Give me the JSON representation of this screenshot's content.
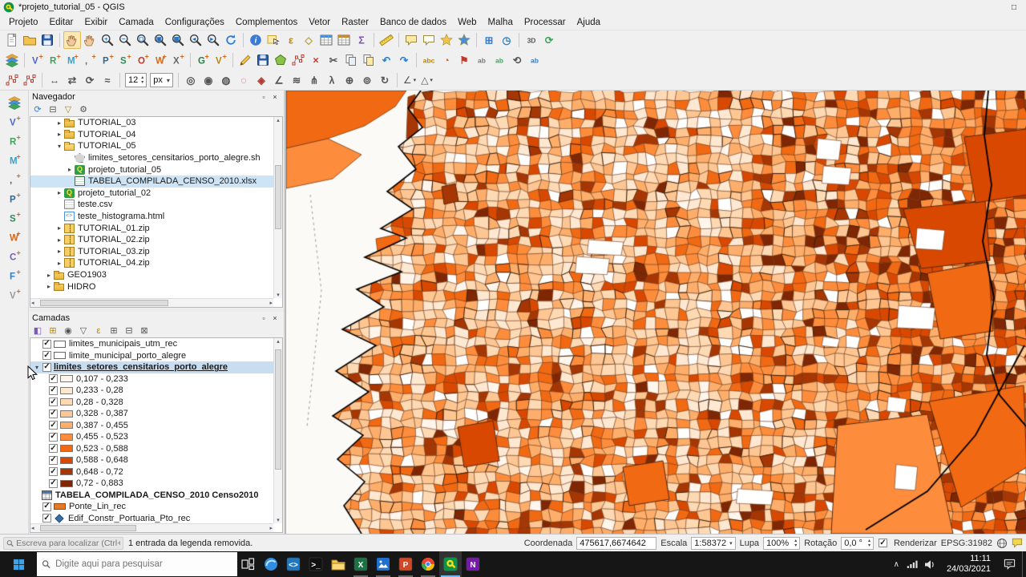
{
  "window": {
    "title": "*projeto_tutorial_05 - QGIS",
    "buttons": [
      {
        "n": "minimize-button",
        "g": "–"
      },
      {
        "n": "maximize-button",
        "g": "□"
      },
      {
        "n": "close-button",
        "g": "×"
      }
    ]
  },
  "icons": {
    "undock": "▫",
    "close": "×",
    "dropdown": "▾",
    "spin_up": "▴",
    "spin_down": "▾",
    "scroll_up": "▴",
    "scroll_down": "▾",
    "scroll_left": "◂",
    "scroll_right": "▸",
    "chevron_up": "∧",
    "check": "✓"
  },
  "menu": {
    "items": [
      "Projeto",
      "Editar",
      "Exibir",
      "Camada",
      "Configurações",
      "Complementos",
      "Vetor",
      "Raster",
      "Banco de dados",
      "Web",
      "Malha",
      "Processar",
      "Ajuda"
    ]
  },
  "toolbars": {
    "row1": [
      {
        "n": "project-new",
        "t": "file"
      },
      {
        "n": "project-open",
        "t": "folder"
      },
      {
        "n": "project-save",
        "t": "disk"
      },
      {
        "sep": true
      },
      {
        "n": "pan-map",
        "t": "hand",
        "active": true
      },
      {
        "n": "pan-to-selection",
        "t": "hand"
      },
      {
        "n": "zoom-in",
        "t": "mag",
        "g": "+"
      },
      {
        "n": "zoom-out",
        "t": "mag",
        "g": "−"
      },
      {
        "n": "zoom-full",
        "t": "mag",
        "g": "◻"
      },
      {
        "n": "zoom-to-selection",
        "t": "mag",
        "g": "▣"
      },
      {
        "n": "zoom-to-layer",
        "t": "mag",
        "g": "▦"
      },
      {
        "n": "zoom-last",
        "t": "mag",
        "g": "◂"
      },
      {
        "n": "zoom-next",
        "t": "mag",
        "g": "▸"
      },
      {
        "n": "map-refresh",
        "t": "refresh"
      },
      {
        "sep": true
      },
      {
        "n": "identify-features",
        "t": "info"
      },
      {
        "n": "select-features",
        "t": "sel"
      },
      {
        "n": "select-by-expression",
        "t": "glyph",
        "g": "ε",
        "c": "#b8860b"
      },
      {
        "n": "deselect-all",
        "t": "glyph",
        "g": "◇",
        "c": "#b8a13d"
      },
      {
        "n": "open-attribute-table",
        "t": "table"
      },
      {
        "n": "field-calculator",
        "t": "table",
        "c": "#c98a2d"
      },
      {
        "n": "statistical-summary",
        "t": "glyph",
        "g": "Σ",
        "c": "#7a5ab5"
      },
      {
        "sep": true
      },
      {
        "n": "measure-line",
        "t": "ruler"
      },
      {
        "sep": true
      },
      {
        "n": "map-tips",
        "t": "balloon",
        "c": "#fde9a8"
      },
      {
        "n": "new-annotation",
        "t": "balloon",
        "c": "#ffffff"
      },
      {
        "n": "new-spatial-bookmark",
        "t": "star",
        "c": "#f3c24e"
      },
      {
        "n": "show-spatial-bookmarks",
        "t": "star",
        "c": "#4a90d9"
      },
      {
        "sep": true
      },
      {
        "n": "new-map-view",
        "t": "glyph",
        "g": "⊞",
        "c": "#3a7bd5"
      },
      {
        "n": "temporal-controller",
        "t": "glyph",
        "g": "◷",
        "c": "#2d7dd2"
      },
      {
        "sep": true
      },
      {
        "n": "new-3d-map-view",
        "t": "glyph",
        "g": "3D",
        "c": "#555555",
        "small": true
      },
      {
        "n": "refresh-3d",
        "t": "glyph",
        "g": "⟳",
        "c": "#3da45c"
      }
    ],
    "row2": [
      {
        "n": "data-source-manager",
        "t": "layers"
      },
      {
        "sep": true
      },
      {
        "n": "add-vector-layer",
        "t": "ltr",
        "g": "V",
        "c": "#4c66c8"
      },
      {
        "n": "add-raster-layer",
        "t": "ltr",
        "g": "R",
        "c": "#3da45c"
      },
      {
        "n": "add-mesh-layer",
        "t": "ltr",
        "g": "M",
        "c": "#38a3c8"
      },
      {
        "n": "add-delimited-text-layer",
        "t": "ltr",
        "g": ",",
        "c": "#666666"
      },
      {
        "n": "add-postgis-layer",
        "t": "ltr",
        "g": "P",
        "c": "#336791"
      },
      {
        "n": "add-spatialite-layer",
        "t": "ltr",
        "g": "S",
        "c": "#2e8b57"
      },
      {
        "n": "add-oracle-layer",
        "t": "ltr",
        "g": "O",
        "c": "#c0392b"
      },
      {
        "n": "add-wms-layer",
        "t": "ltr",
        "g": "W",
        "c": "#d2691e"
      },
      {
        "n": "add-xyz-layer",
        "t": "ltr",
        "g": "X",
        "c": "#666666"
      },
      {
        "sep": true
      },
      {
        "n": "new-geopackage-layer",
        "t": "ltr",
        "g": "G",
        "c": "#2d7d4d"
      },
      {
        "n": "new-shapefile-layer",
        "t": "ltr",
        "g": "V",
        "c": "#b8860b"
      },
      {
        "sep": true
      },
      {
        "n": "toggle-editing",
        "t": "pencil"
      },
      {
        "n": "save-layer-edits",
        "t": "disk"
      },
      {
        "n": "add-feature",
        "t": "poly"
      },
      {
        "n": "vertex-tool",
        "t": "node"
      },
      {
        "n": "delete-selected",
        "t": "glyph",
        "g": "×",
        "c": "#c0392b"
      },
      {
        "n": "cut-features",
        "t": "glyph",
        "g": "✂",
        "c": "#555555"
      },
      {
        "n": "copy-features",
        "t": "copy"
      },
      {
        "n": "paste-features",
        "t": "copy",
        "c": "#fde9a8"
      },
      {
        "n": "undo",
        "t": "glyph",
        "g": "↶",
        "c": "#2d7dd2"
      },
      {
        "n": "redo",
        "t": "glyph",
        "g": "↷",
        "c": "#2d7dd2"
      },
      {
        "sep": true
      },
      {
        "n": "layer-labeling-options",
        "t": "glyph",
        "g": "abc",
        "c": "#b8860b",
        "small": true
      },
      {
        "n": "layer-diagram-options",
        "t": "glyph",
        "g": "◔",
        "c": "#d2691e"
      },
      {
        "n": "pin-labels",
        "t": "glyph",
        "g": "⚑",
        "c": "#c0392b"
      },
      {
        "n": "highlight-pinned-labels",
        "t": "glyph",
        "g": "ab",
        "c": "#777777",
        "small": true
      },
      {
        "n": "move-label",
        "t": "glyph",
        "g": "ab",
        "c": "#3da45c",
        "small": true
      },
      {
        "n": "rotate-label",
        "t": "glyph",
        "g": "⟲",
        "c": "#555555"
      },
      {
        "n": "change-label",
        "t": "glyph",
        "g": "ab",
        "c": "#2d7dd2",
        "small": true
      }
    ],
    "row3": [
      {
        "n": "vertex-tool-all-layers",
        "t": "node"
      },
      {
        "n": "vertex-tool-active-layer",
        "t": "node"
      },
      {
        "sep": true
      },
      {
        "n": "move-feature",
        "t": "glyph",
        "g": "↔",
        "c": "#555555"
      },
      {
        "n": "copy-move-feature",
        "t": "glyph",
        "g": "⇄",
        "c": "#555555"
      },
      {
        "n": "rotate-feature",
        "t": "glyph",
        "g": "⟳",
        "c": "#555555"
      },
      {
        "n": "simplify-feature",
        "t": "glyph",
        "g": "≈",
        "c": "#555555"
      },
      {
        "sep": true
      },
      {
        "n": "font-size",
        "t": "spin",
        "v": "12"
      },
      {
        "n": "font-unit",
        "t": "combo",
        "v": "px"
      },
      {
        "sep": true
      },
      {
        "n": "add-ring",
        "t": "glyph",
        "g": "◎",
        "c": "#555555"
      },
      {
        "n": "add-part",
        "t": "glyph",
        "g": "◉",
        "c": "#555555"
      },
      {
        "n": "fill-ring",
        "t": "glyph",
        "g": "◍",
        "c": "#555555"
      },
      {
        "n": "delete-ring",
        "t": "glyph",
        "g": "◌",
        "c": "#b03a2e"
      },
      {
        "n": "delete-part",
        "t": "glyph",
        "g": "◈",
        "c": "#b03a2e"
      },
      {
        "n": "reshape-features",
        "t": "glyph",
        "g": "∠",
        "c": "#555555"
      },
      {
        "n": "offset-curve",
        "t": "glyph",
        "g": "≋",
        "c": "#555555"
      },
      {
        "n": "split-features",
        "t": "glyph",
        "g": "⋔",
        "c": "#555555"
      },
      {
        "n": "split-parts",
        "t": "glyph",
        "g": "λ",
        "c": "#555555"
      },
      {
        "n": "merge-features",
        "t": "glyph",
        "g": "⊕",
        "c": "#555555"
      },
      {
        "n": "merge-attributes",
        "t": "glyph",
        "g": "⊚",
        "c": "#555555"
      },
      {
        "n": "rotate-point-symbols",
        "t": "glyph",
        "g": "↻",
        "c": "#555555"
      },
      {
        "sep": true
      },
      {
        "n": "trim-extend",
        "t": "comboIcon",
        "g": "∠"
      },
      {
        "n": "advanced-digitizing",
        "t": "comboIcon",
        "g": "△"
      }
    ],
    "left": [
      {
        "n": "open-data-source-manager",
        "t": "layers"
      },
      {
        "n": "add-vector-layer",
        "t": "ltr",
        "g": "V",
        "c": "#4c66c8"
      },
      {
        "n": "add-raster-layer",
        "t": "ltr",
        "g": "R",
        "c": "#3da45c"
      },
      {
        "n": "add-mesh-layer",
        "t": "ltr",
        "g": "M",
        "c": "#38a3c8"
      },
      {
        "n": "add-delimited-text-layer",
        "t": "ltr",
        "g": ",",
        "c": "#555555"
      },
      {
        "n": "add-postgis-layer",
        "t": "ltr",
        "g": "P",
        "c": "#336791"
      },
      {
        "n": "add-spatialite-layer",
        "t": "ltr",
        "g": "S",
        "c": "#2e8b57"
      },
      {
        "n": "add-wms-wmts-layer",
        "t": "ltr",
        "g": "W",
        "c": "#d2691e"
      },
      {
        "n": "add-wcs-layer",
        "t": "ltr",
        "g": "C",
        "c": "#7a5ab5"
      },
      {
        "n": "add-wfs-layer",
        "t": "ltr",
        "g": "F",
        "c": "#2d7dd2"
      },
      {
        "n": "add-virtual-layer",
        "t": "ltr",
        "g": "V",
        "c": "#9a9a9a"
      }
    ]
  },
  "browser_panel": {
    "title": "Navegador",
    "tools": [
      {
        "n": "browser-refresh",
        "g": "⟳",
        "c": "#2d7dd2"
      },
      {
        "n": "browser-collapse-all",
        "g": "⊟",
        "c": "#555555"
      },
      {
        "n": "browser-filter",
        "g": "▽",
        "c": "#b8860b"
      },
      {
        "n": "browser-properties",
        "g": "⚙",
        "c": "#555555"
      }
    ],
    "items": [
      {
        "ind": 2,
        "arrow": "▸",
        "icon": "folder",
        "label": "TUTORIAL_03"
      },
      {
        "ind": 2,
        "arrow": "▸",
        "icon": "folder",
        "label": "TUTORIAL_04"
      },
      {
        "ind": 2,
        "arrow": "▾",
        "icon": "folderO",
        "label": "TUTORIAL_05"
      },
      {
        "ind": 3,
        "arrow": "",
        "icon": "vector",
        "label": "limites_setores_censitarios_porto_alegre.sh"
      },
      {
        "ind": 3,
        "arrow": "▸",
        "icon": "qgis",
        "label": "projeto_tutorial_05"
      },
      {
        "ind": 3,
        "arrow": "",
        "icon": "xlsx",
        "label": "TABELA_COMPILADA_CENSO_2010.xlsx",
        "selected": true
      },
      {
        "ind": 2,
        "arrow": "▸",
        "icon": "qgis",
        "label": "projeto_tutorial_02"
      },
      {
        "ind": 2,
        "arrow": "",
        "icon": "csv",
        "label": "teste.csv"
      },
      {
        "ind": 2,
        "arrow": "",
        "icon": "html",
        "label": "teste_histograma.html"
      },
      {
        "ind": 2,
        "arrow": "▸",
        "icon": "zip",
        "label": "TUTORIAL_01.zip"
      },
      {
        "ind": 2,
        "arrow": "▸",
        "icon": "zip",
        "label": "TUTORIAL_02.zip"
      },
      {
        "ind": 2,
        "arrow": "▸",
        "icon": "zip",
        "label": "TUTORIAL_03.zip"
      },
      {
        "ind": 2,
        "arrow": "▸",
        "icon": "zip",
        "label": "TUTORIAL_04.zip"
      },
      {
        "ind": 1,
        "arrow": "▸",
        "icon": "folder",
        "label": "GEO1903"
      },
      {
        "ind": 1,
        "arrow": "▸",
        "icon": "folder",
        "label": "HIDRO"
      }
    ]
  },
  "layers_panel": {
    "title": "Camadas",
    "tools": [
      {
        "n": "open-layer-styling-panel",
        "g": "◧",
        "c": "#7a5ab5"
      },
      {
        "n": "add-group",
        "g": "⊞",
        "c": "#b8860b"
      },
      {
        "n": "manage-map-themes",
        "g": "◉",
        "c": "#555555"
      },
      {
        "n": "filter-legend",
        "g": "▽",
        "c": "#555555"
      },
      {
        "n": "filter-by-expression",
        "g": "ε",
        "c": "#b8860b"
      },
      {
        "n": "expand-all",
        "g": "⊞",
        "c": "#555555"
      },
      {
        "n": "collapse-all",
        "g": "⊟",
        "c": "#555555"
      },
      {
        "n": "remove-layer-group",
        "g": "⊠",
        "c": "#555555"
      }
    ],
    "layers": [
      {
        "arrow": "",
        "chk": true,
        "swatch": "rect",
        "label": "limites_municipais_utm_rec"
      },
      {
        "arrow": "",
        "chk": true,
        "swatch": "rect",
        "label": "limite_municipal_porto_alegre"
      },
      {
        "arrow": "▾",
        "chk": true,
        "label": "limites_setores_censitarios_porto_alegre",
        "selected": true
      },
      {
        "cls": true,
        "chk": true,
        "color": "#fff5eb",
        "label": "0,107 - 0,233"
      },
      {
        "cls": true,
        "chk": true,
        "color": "#fee8d2",
        "label": "0,233 - 0,28"
      },
      {
        "cls": true,
        "chk": true,
        "color": "#fdd9b4",
        "label": "0,28 - 0,328"
      },
      {
        "cls": true,
        "chk": true,
        "color": "#fdc692",
        "label": "0,328 - 0,387"
      },
      {
        "cls": true,
        "chk": true,
        "color": "#fdae6b",
        "label": "0,387 - 0,455"
      },
      {
        "cls": true,
        "chk": true,
        "color": "#fd8d3c",
        "label": "0,455 - 0,523"
      },
      {
        "cls": true,
        "chk": true,
        "color": "#f16913",
        "label": "0,523 - 0,588"
      },
      {
        "cls": true,
        "chk": true,
        "color": "#d94801",
        "label": "0,588 - 0,648"
      },
      {
        "cls": true,
        "chk": true,
        "color": "#a63603",
        "label": "0,648 - 0,72"
      },
      {
        "cls": true,
        "chk": true,
        "color": "#7f2704",
        "label": "0,72 - 0,883"
      },
      {
        "arrow": "",
        "icon": "table",
        "label": "TABELA_COMPILADA_CENSO_2010 Censo2010",
        "bold": true
      },
      {
        "arrow": "",
        "chk": true,
        "swatch": "line",
        "color": "#e87b22",
        "label": "Ponte_Lin_rec"
      },
      {
        "arrow": "",
        "chk": true,
        "swatch": "diamond",
        "color": "#3a6ea5",
        "label": "Edif_Constr_Portuaria_Pto_rec"
      }
    ]
  },
  "map": {
    "palette": [
      "#fff5eb",
      "#fee8d2",
      "#fdd9b4",
      "#fdc692",
      "#fdae6b",
      "#fd8d3c",
      "#f16913",
      "#d94801",
      "#a63603",
      "#7f2704"
    ],
    "water": "#fbfaf6",
    "outline": "#6b3310",
    "boundary": "#000000"
  },
  "status_bar": {
    "locator_placeholder": "Escreva para localizar (Ctrl+K)",
    "message": "1 entrada da legenda removida.",
    "coordinate_label": "Coordenada",
    "coordinate_value": "475617,6674642",
    "scale_label": "Escala",
    "scale_value": "1:58372",
    "magnifier_label": "Lupa",
    "magnifier_value": "100%",
    "rotation_label": "Rotação",
    "rotation_value": "0,0 °",
    "render_label": "Renderizar",
    "epsg_value": "EPSG:31982"
  },
  "taskbar": {
    "search_placeholder": "Digite aqui para pesquisar",
    "time": "11:11",
    "date": "24/03/2021",
    "apps": [
      {
        "n": "task-view-button",
        "kind": "taskview"
      },
      {
        "n": "app-edge",
        "kind": "circle",
        "c": "#2f8ee0"
      },
      {
        "n": "app-vscode",
        "kind": "square",
        "c": "#1f77c0",
        "g": "<>"
      },
      {
        "n": "app-terminal",
        "kind": "square",
        "c": "#101010",
        "g": ">_"
      },
      {
        "n": "app-explorer",
        "kind": "folder"
      },
      {
        "n": "app-excel",
        "kind": "square",
        "c": "#1e7145",
        "g": "X",
        "open": true
      },
      {
        "n": "app-photos",
        "kind": "photos",
        "open": true
      },
      {
        "n": "app-powerpoint",
        "kind": "square",
        "c": "#d24726",
        "g": "P",
        "open": true
      },
      {
        "n": "app-chrome",
        "kind": "chrome",
        "open": true
      },
      {
        "n": "app-qgis",
        "kind": "qgis",
        "active": true
      },
      {
        "n": "app-onenote",
        "kind": "square",
        "c": "#7719aa",
        "g": "N"
      }
    ]
  }
}
